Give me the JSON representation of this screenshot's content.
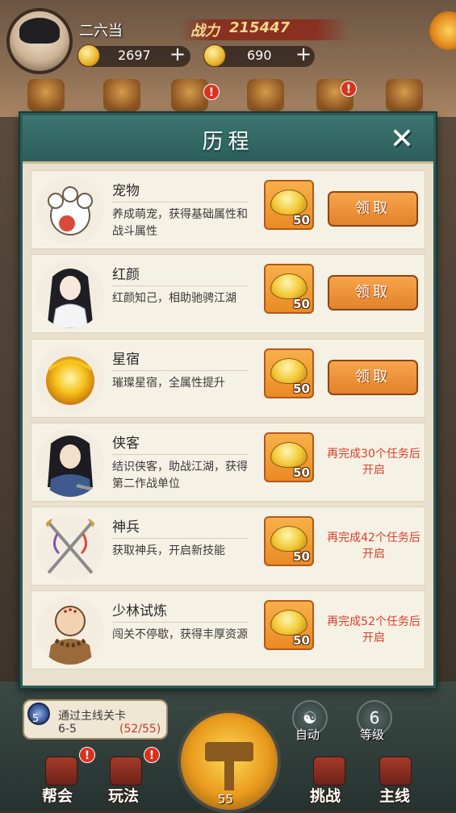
{
  "player": {
    "name": "二六当",
    "power_label": "战力",
    "power_value": "215447",
    "coins": "2697",
    "ingots": "690",
    "plus": "+"
  },
  "shelf_badge": "!",
  "modal": {
    "title": "历程",
    "close": "✕",
    "rows": [
      {
        "title": "宠物",
        "desc": "养成萌宠，获得基础属性和战斗属性",
        "reward": "50",
        "action": "领取",
        "locked": ""
      },
      {
        "title": "红颜",
        "desc": "红颜知己，相助驰骋江湖",
        "reward": "50",
        "action": "领取",
        "locked": ""
      },
      {
        "title": "星宿",
        "desc": "璀璨星宿，全属性提升",
        "reward": "50",
        "action": "领取",
        "locked": ""
      },
      {
        "title": "侠客",
        "desc": "结识侠客，助战江湖，获得第二作战单位",
        "reward": "50",
        "action": "",
        "locked": "再完成30个任务后开启"
      },
      {
        "title": "神兵",
        "desc": "获取神兵，开启新技能",
        "reward": "50",
        "action": "",
        "locked": "再完成42个任务后开启"
      },
      {
        "title": "少林试炼",
        "desc": "闯关不停歇，获得丰厚资源",
        "reward": "50",
        "action": "",
        "locked": "再完成52个任务后开启"
      }
    ]
  },
  "hud": {
    "stage_badge": "5",
    "stage_label": "通过主线关卡",
    "stage_code": "6-5",
    "stage_progress": "(52/55)",
    "auto_label": "自动",
    "level_value": "6",
    "level_label": "等级",
    "main_level": "55"
  },
  "nav": {
    "guild": "帮会",
    "play": "玩法",
    "challenge": "挑战",
    "mainline": "主线"
  },
  "colors": {
    "header_teal": "#2b5e5a",
    "claim_orange": "#e3822b",
    "locked_red": "#d8402a"
  }
}
